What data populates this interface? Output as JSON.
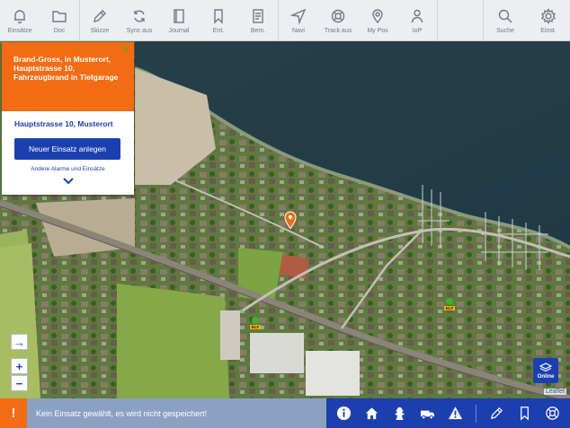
{
  "toolbar": {
    "items": [
      {
        "label": "Einsätze",
        "icon": "bell-icon"
      },
      {
        "label": "Doc",
        "icon": "folder-icon"
      },
      {
        "label": "Skizze",
        "icon": "pencil-icon"
      },
      {
        "label": "Sync aus",
        "icon": "sync-icon"
      },
      {
        "label": "Journal",
        "icon": "journal-icon"
      },
      {
        "label": "Ent.",
        "icon": "bookmark-icon"
      },
      {
        "label": "Bem.",
        "icon": "note-icon"
      },
      {
        "label": "Navi",
        "icon": "navigation-icon"
      },
      {
        "label": "Track aus",
        "icon": "lifebuoy-icon"
      },
      {
        "label": "My Pos",
        "icon": "location-pin-icon"
      },
      {
        "label": "IoP",
        "icon": "person-icon"
      },
      {
        "label": "Suche",
        "icon": "search-icon"
      },
      {
        "label": "Einst.",
        "icon": "gear-icon"
      }
    ]
  },
  "panel": {
    "title": "Brand-Gross, in Musterort, Hauptstrasse 10, Fahrzeugbrand in Tiefgarage",
    "address": "Hauptstrasse 10, Musterort",
    "button": "Neuer Einsatz anlegen",
    "link": "Andere Alarme und Einsätze"
  },
  "map": {
    "controls": {
      "locate": "→",
      "zoom_in": "+",
      "zoom_out": "−"
    },
    "layers_label": "Online",
    "attribution": "Leaflet",
    "markers": [
      {
        "type": "incident",
        "color": "#f36b12"
      },
      {
        "type": "vehicle",
        "label": "ELF"
      },
      {
        "type": "vehicle",
        "label": "ELF"
      },
      {
        "type": "vehicle",
        "label": "ELF"
      }
    ]
  },
  "bottombar": {
    "warning": "!",
    "message": "Kein Einsatz gewählt, es wird nicht gespeichert!",
    "icons": [
      "info-icon",
      "home-icon",
      "fire-hydrant-icon",
      "truck-icon",
      "warning-icon",
      "pencil-icon",
      "bookmark-icon",
      "lifebuoy-icon"
    ]
  },
  "colors": {
    "accent": "#1c3fb0",
    "alert": "#f36b12",
    "toolbar_bg": "#eceef1"
  }
}
